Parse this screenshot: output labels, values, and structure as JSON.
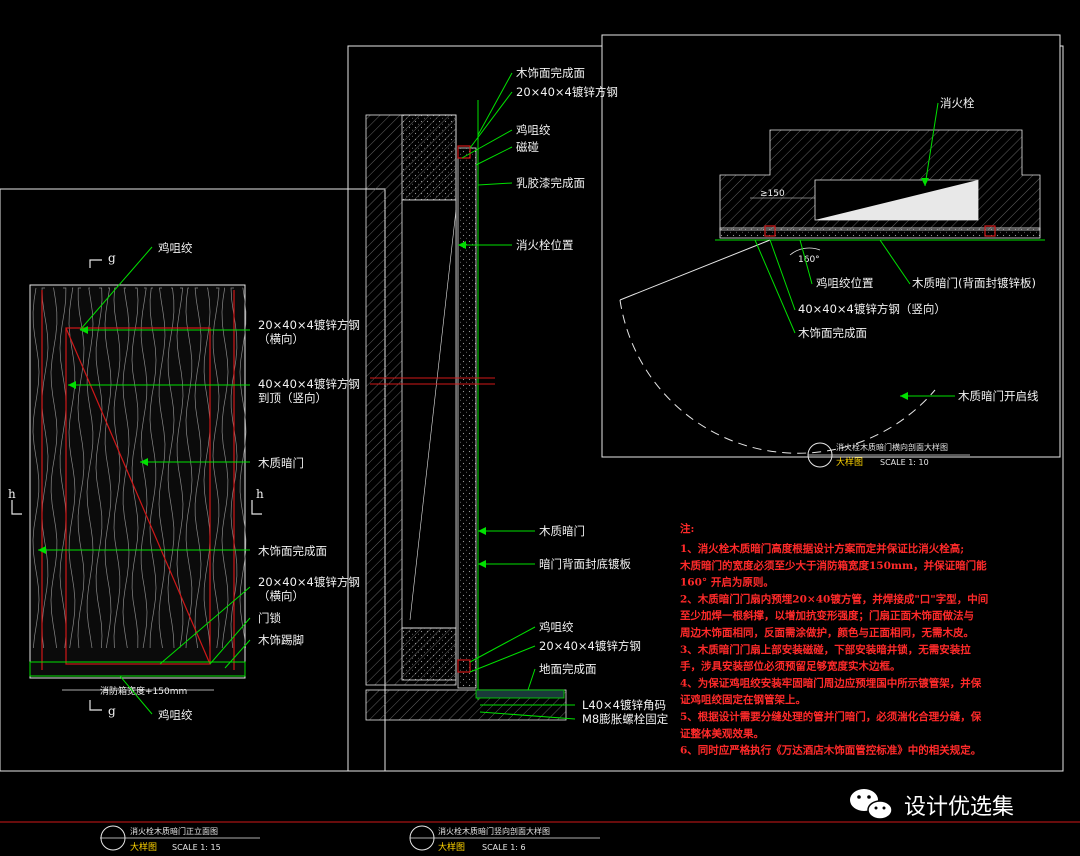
{
  "colors": {
    "background": "#000000",
    "frame": "#e6e6e6",
    "leader": "#00e000",
    "steel": "#d01818",
    "wood_grain": "#8a8a8a",
    "note_red": "#ff2a2a",
    "title_yellow": "#ffd400"
  },
  "elevation": {
    "section_marks": {
      "g": "g",
      "h": "h"
    },
    "labels": {
      "hinge_top": "鸡咀绞",
      "tube_horizontal": "20×40×4镀锌方钢\n（横向）",
      "tube_vertical": "40×40×4镀锌方钢\n到顶（竖向）",
      "door": "木质暗门",
      "finish": "木饰面完成面",
      "tube_horizontal_2": "20×40×4镀锌方钢\n（横向）",
      "lock": "门锁",
      "skirting": "木饰踢脚",
      "hinge_bottom": "鸡咀绞"
    },
    "dimension_text": "消防箱宽度+150mm",
    "title": {
      "name": "消火栓木质暗门正立面图",
      "type": "大样图",
      "scale": "SCALE 1: 15"
    }
  },
  "vertical_section": {
    "labels": {
      "finish_top": "木饰面完成面",
      "tube_top": "20×40×4镀锌方钢",
      "hinge_top": "鸡咀绞",
      "magnet": "磁碰",
      "latex": "乳胶漆完成面",
      "hydrant_pos": "消火栓位置",
      "door": "木质暗门",
      "back_board": "暗门背面封底镀板",
      "hinge_bottom": "鸡咀绞",
      "tube_bottom": "20×40×4镀锌方钢",
      "floor": "地面完成面",
      "angle": "L40×4镀锌角码",
      "bolt": "M8膨胀螺栓固定"
    },
    "title": {
      "name": "消火栓木质暗门竖向剖面大样图",
      "type": "大样图",
      "scale": "SCALE 1: 6"
    }
  },
  "horizontal_section": {
    "labels": {
      "hydrant": "消火栓",
      "hinge_pos": "鸡咀绞位置",
      "door": "木质暗门(背面封镀锌板)",
      "tube": "40×40×4镀锌方钢（竖向）",
      "finish": "木饰面完成面",
      "swing": "木质暗门开启线"
    },
    "dimension_text": "≥150",
    "angle_text": "160°",
    "title": {
      "name": "消火栓木质暗门横向剖面大样图",
      "type": "大样图",
      "scale": "SCALE 1: 10"
    }
  },
  "notes": {
    "heading": "注:",
    "lines": [
      "1、消火栓木质暗门高度根据设计方案而定并保证比消火栓高;",
      "木质暗门的宽度必须至少大于消防箱宽度150mm，并保证暗门能",
      "160° 开启为原则。",
      "2、木质暗门门扇内预埋20×40镀方管，并焊接成\"口\"字型，中间",
      "至少加焊一根斜撑，以增加抗变形强度；门扇正面木饰面做法与",
      "周边木饰面相同，反面需涂做护，颜色与正面相同，无需木皮。",
      "3、木质暗门门扇上部安装磁碰，下部安装暗井锁，无需安装拉",
      "手，涉具安装部位必须预留足够宽度实木边框。",
      "4、为保证鸡咀绞安装牢固暗门周边应预埋国中所示镀管架，并保",
      "证鸡咀绞固定在钢管架上。",
      "5、根据设计需要分缝处理的管并门暗门，必须湍化合理分缝，保",
      "证整体美观效果。",
      "6、同时应严格执行《万达酒店木饰面管控标准》中的相关规定。"
    ]
  },
  "watermark": {
    "icon": "wechat-icon",
    "text": "设计优选集"
  }
}
